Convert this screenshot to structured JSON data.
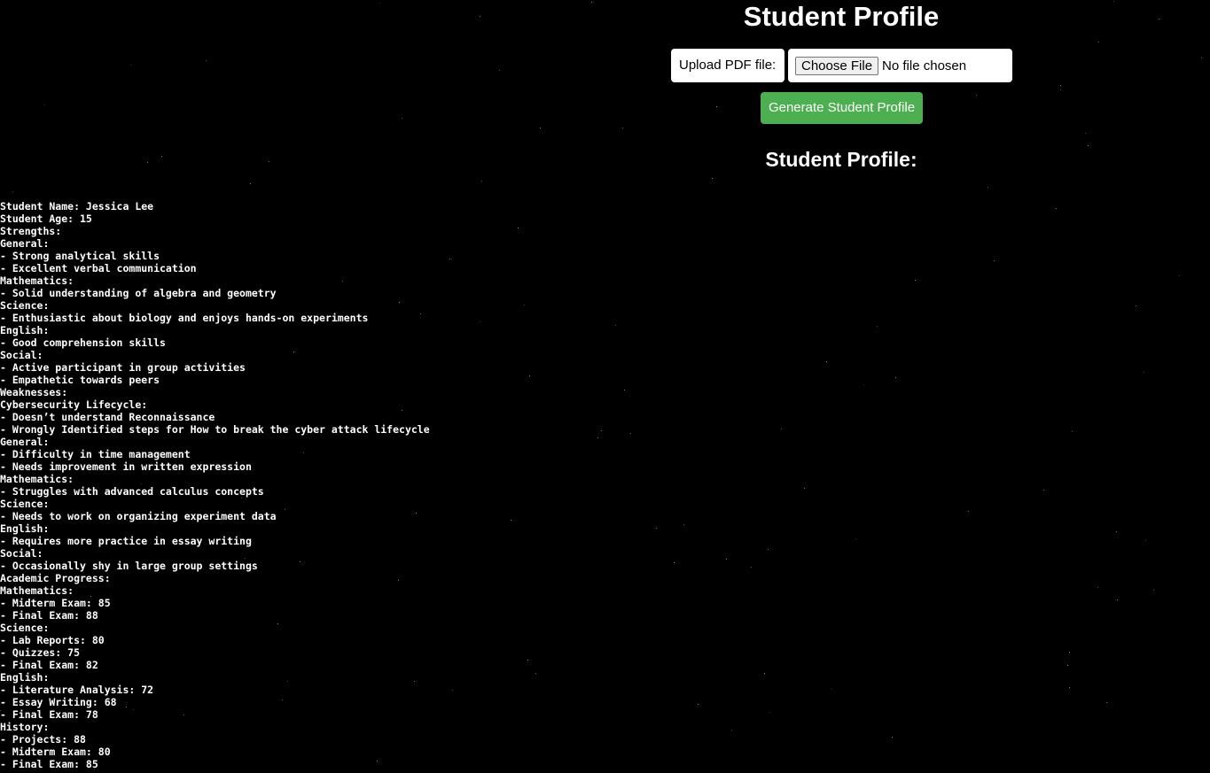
{
  "page": {
    "title": "Student Profile",
    "background_color": "#000000",
    "accent_color": "#4caf50"
  },
  "upload": {
    "label": "Upload PDF file:",
    "choose_button": "Choose File",
    "file_status": "No file chosen"
  },
  "generate_button": "Generate Student Profile",
  "profile_heading": "Student Profile:",
  "profile_lines": [
    "Student Name: Jessica Lee",
    "Student Age: 15",
    "Strengths:",
    "General:",
    "- Strong analytical skills",
    "- Excellent verbal communication",
    "Mathematics:",
    "- Solid understanding of algebra and geometry",
    "Science:",
    "- Enthusiastic about biology and enjoys hands-on experiments",
    "English:",
    "- Good comprehension skills",
    "Social:",
    "- Active participant in group activities",
    "- Empathetic towards peers",
    "Weaknesses:",
    "Cybersecurity Lifecycle:",
    "- Doesn’t understand Reconnaissance",
    "- Wrongly Identified steps for How to break the cyber attack lifecycle",
    "General:",
    "- Difficulty in time management",
    "- Needs improvement in written expression",
    "Mathematics:",
    "- Struggles with advanced calculus concepts",
    "Science:",
    "- Needs to work on organizing experiment data",
    "English:",
    "- Requires more practice in essay writing",
    "Social:",
    "- Occasionally shy in large group settings",
    "Academic Progress:",
    "Mathematics:",
    "- Midterm Exam: 85",
    "- Final Exam: 88",
    "Science:",
    "- Lab Reports: 80",
    "- Quizzes: 75",
    "- Final Exam: 82",
    "English:",
    "- Literature Analysis: 72",
    "- Essay Writing: 68",
    "- Final Exam: 78",
    "History:",
    "- Projects: 88",
    "- Midterm Exam: 80",
    "- Final Exam: 85"
  ]
}
